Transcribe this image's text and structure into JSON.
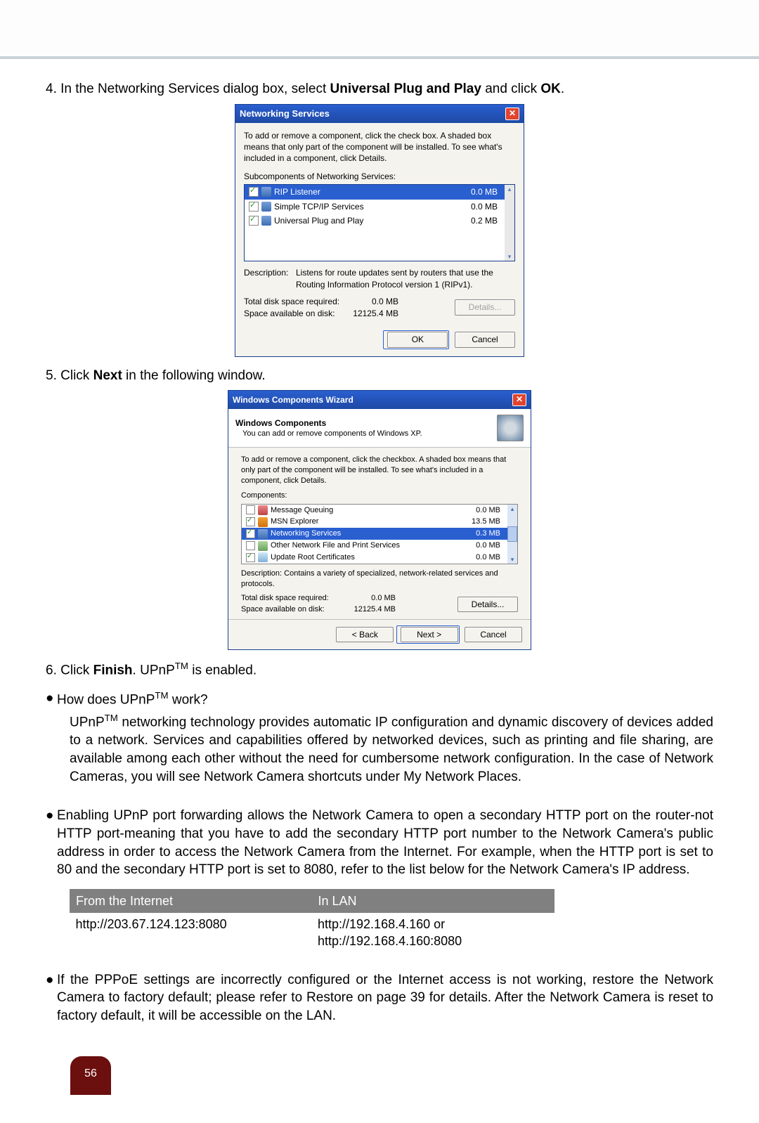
{
  "step4": {
    "num": "4.",
    "pre": "In the Networking Services dialog box, select ",
    "bold": "Universal Plug and Play",
    "mid": " and click ",
    "bold2": "OK",
    "post": "."
  },
  "dlg1": {
    "title": "Networking Services",
    "intro": "To add or remove a component, click the check box. A shaded box means that only part of the component will be installed. To see what's included in a component, click Details.",
    "sublabel": "Subcomponents of Networking Services:",
    "rows": [
      {
        "checked": true,
        "label": "RIP Listener",
        "size": "0.0 MB",
        "selected": true
      },
      {
        "checked": true,
        "label": "Simple TCP/IP Services",
        "size": "0.0 MB",
        "selected": false
      },
      {
        "checked": true,
        "label": "Universal Plug and Play",
        "size": "0.2 MB",
        "selected": false
      }
    ],
    "desc_label": "Description:",
    "desc_text": "Listens for route updates sent by routers that use the Routing Information Protocol version 1 (RIPv1).",
    "space": {
      "req_label": "Total disk space required:",
      "req_val": "0.0 MB",
      "avail_label": "Space available on disk:",
      "avail_val": "12125.4 MB"
    },
    "details_btn": "Details...",
    "ok_btn": "OK",
    "cancel_btn": "Cancel"
  },
  "step5": {
    "num": "5.",
    "pre": "Click ",
    "bold": "Next",
    "post": " in the following window."
  },
  "dlg2": {
    "title": "Windows Components Wizard",
    "header_title": "Windows Components",
    "header_sub": "You can add or remove components of Windows XP.",
    "intro": "To add or remove a component, click the checkbox. A shaded box means that only part of the component will be installed. To see what's included in a component, click Details.",
    "comp_label": "Components:",
    "rows": [
      {
        "checked": false,
        "icon": "icon-msg",
        "label": "Message Queuing",
        "size": "0.0 MB",
        "selected": false
      },
      {
        "checked": true,
        "icon": "icon-msn",
        "label": "MSN Explorer",
        "size": "13.5 MB",
        "selected": false
      },
      {
        "checked": true,
        "icon": "icon-net",
        "label": "Networking Services",
        "size": "0.3 MB",
        "selected": true
      },
      {
        "checked": false,
        "icon": "icon-file",
        "label": "Other Network File and Print Services",
        "size": "0.0 MB",
        "selected": false
      },
      {
        "checked": true,
        "icon": "icon-cert",
        "label": "Update Root Certificates",
        "size": "0.0 MB",
        "selected": false
      }
    ],
    "desc": "Description:  Contains a variety of specialized, network-related services and protocols.",
    "space": {
      "req_label": "Total disk space required:",
      "req_val": "0.0 MB",
      "avail_label": "Space available on disk:",
      "avail_val": "12125.4 MB"
    },
    "details_btn": "Details...",
    "back_btn": "< Back",
    "next_btn": "Next >",
    "cancel_btn": "Cancel"
  },
  "step6": {
    "num": "6.",
    "pre": "Click ",
    "bold": "Finish",
    "mid": ". UPnP",
    "tm": "TM",
    "post": " is enabled."
  },
  "how_bullet": {
    "dot": "●",
    "pre": "How does UPnP",
    "tm": "TM",
    "post": " work?"
  },
  "how_para": {
    "s1a": "UPnP",
    "tm": "TM",
    "s1b": " networking technology provides automatic IP configuration and dynamic discovery of devices added to a network. Services and capabilities offered by networked devices, such as printing and file sharing, are available among each other without the need for cumbersome network configuration. In the case of Network Cameras, you will see Network Camera shortcuts under My Network Places."
  },
  "enable_bullet": {
    "dot": "●",
    "text": "Enabling UPnP port forwarding allows the Network Camera to open a secondary HTTP port on the router-not HTTP port-meaning that you have to add the secondary HTTP port number to the Network Camera's public address in order to access the Network Camera from the Internet. For example, when the HTTP port is set to 80 and the secondary HTTP port is set to 8080, refer to the list below for the Network Camera's IP address."
  },
  "iptable": {
    "h1": "From the Internet",
    "h2": "In LAN",
    "c1": "http://203.67.124.123:8080",
    "c2a": "http://192.168.4.160 or",
    "c2b": "http://192.168.4.160:8080"
  },
  "pppoe_bullet": {
    "dot": "●",
    "text": "If the PPPoE settings are incorrectly configured or the Internet access is not working, restore the Network Camera to factory default; please refer to Restore on page 39 for details. After the Network Camera is reset to factory default, it will be accessible on the LAN."
  },
  "page_number": "56"
}
